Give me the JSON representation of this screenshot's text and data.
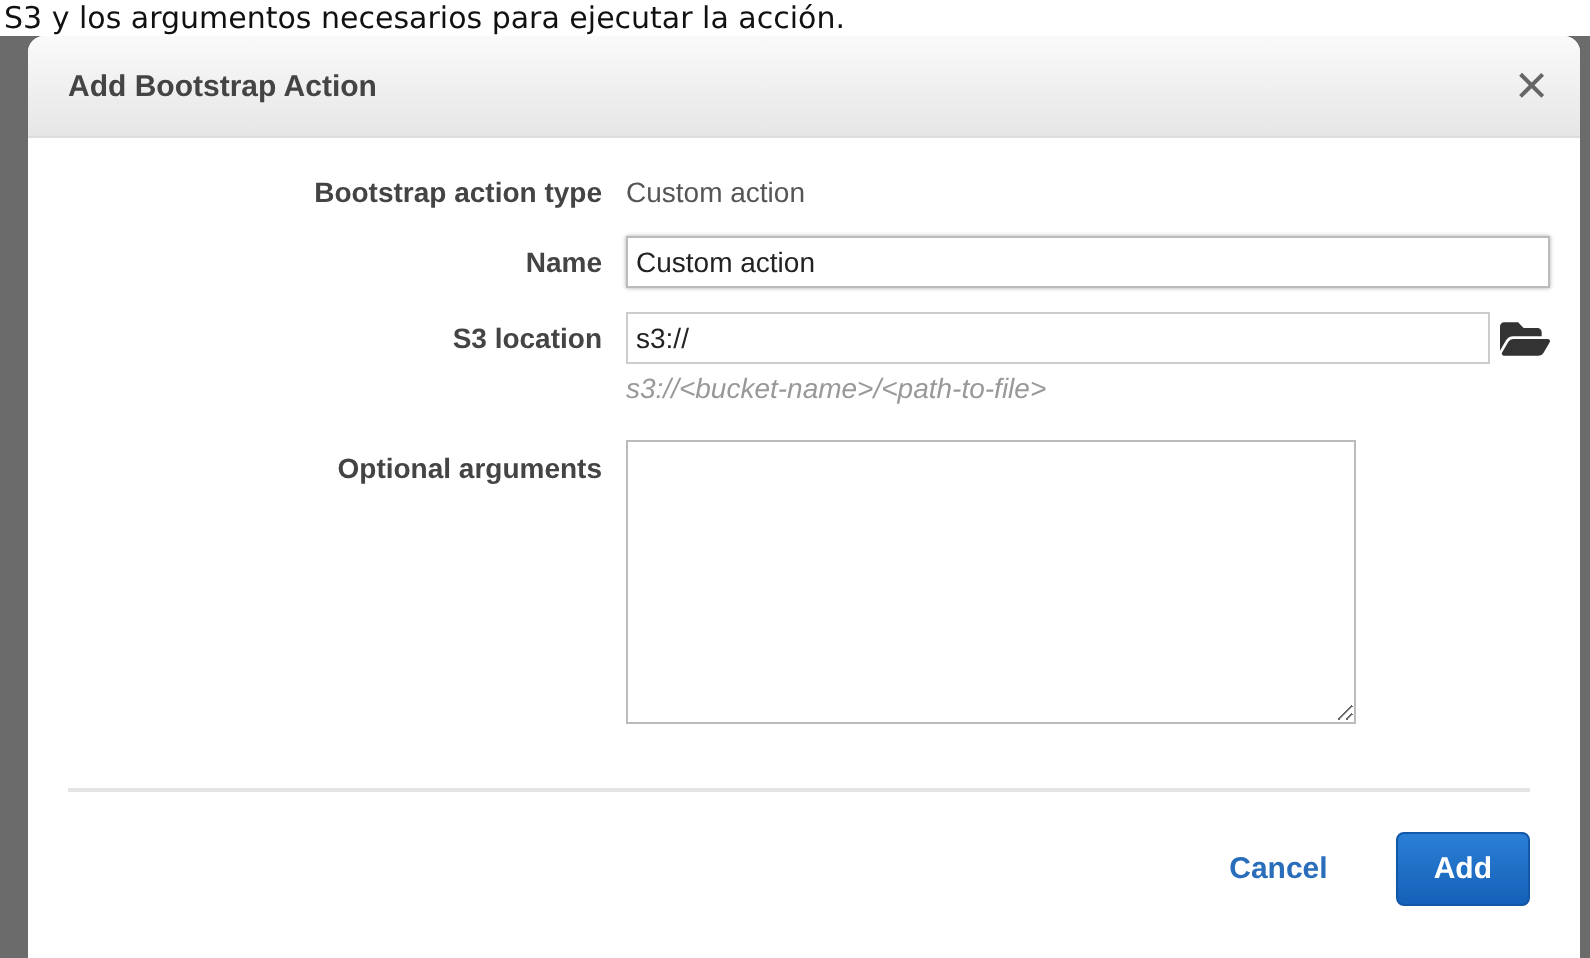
{
  "background_text": "S3 y los argumentos necesarios para ejecutar la acción.",
  "dialog": {
    "title": "Add Bootstrap Action",
    "close": "×",
    "fields": [
      {
        "kind": "static",
        "label": "Bootstrap action type",
        "value": "Custom action"
      },
      {
        "kind": "text",
        "label": "Name",
        "value": "Custom action",
        "focused": true
      },
      {
        "kind": "browse",
        "label": "S3 location",
        "value": "s3://",
        "hint": "s3://<bucket-name>/<path-to-file>"
      },
      {
        "kind": "textarea",
        "label": "Optional arguments"
      }
    ],
    "buttons": [
      {
        "label": "Cancel",
        "primary": false
      },
      {
        "label": "Add",
        "primary": true
      }
    ]
  }
}
